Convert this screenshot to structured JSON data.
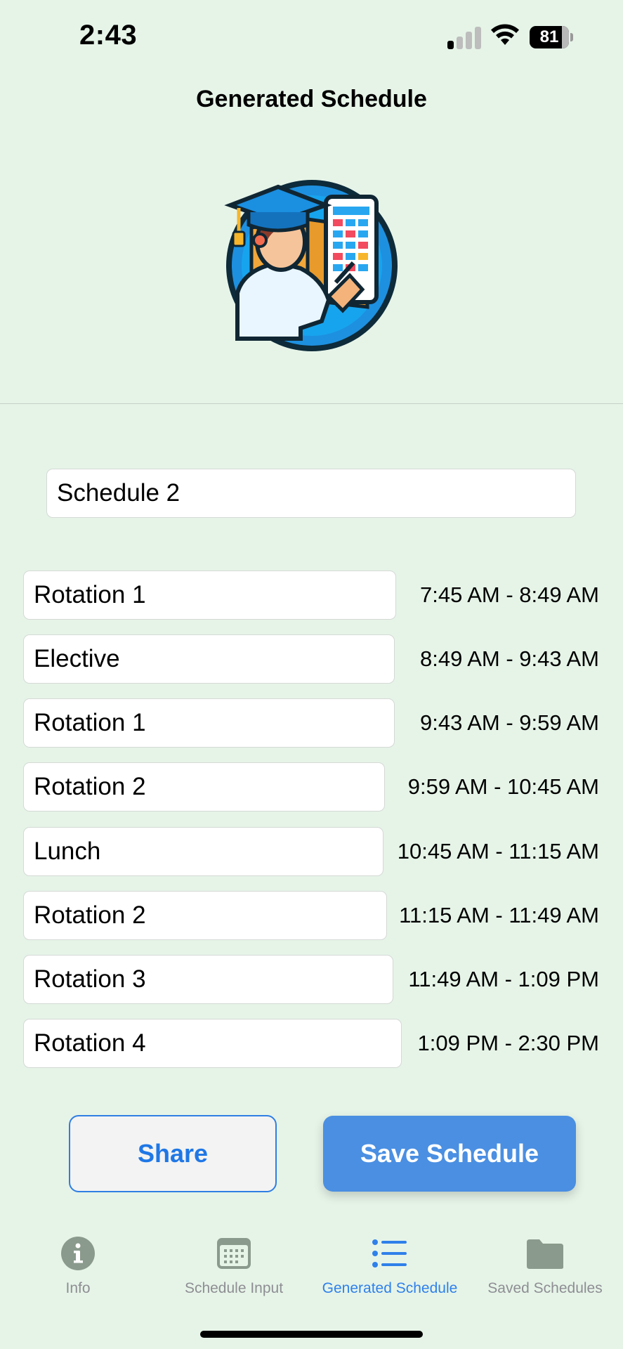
{
  "status_bar": {
    "time": "2:43",
    "battery_level": "81"
  },
  "header": {
    "title": "Generated Schedule"
  },
  "schedule_name": "Schedule 2",
  "schedule": [
    {
      "label": "Rotation 1",
      "time": "7:45 AM - 8:49 AM"
    },
    {
      "label": "Elective",
      "time": "8:49 AM - 9:43 AM"
    },
    {
      "label": "Rotation 1",
      "time": "9:43 AM - 9:59 AM"
    },
    {
      "label": "Rotation 2",
      "time": "9:59 AM - 10:45 AM"
    },
    {
      "label": "Lunch",
      "time": "10:45 AM - 11:15 AM"
    },
    {
      "label": "Rotation 2",
      "time": "11:15 AM - 11:49 AM"
    },
    {
      "label": "Rotation 3",
      "time": "11:49 AM - 1:09 PM"
    },
    {
      "label": "Rotation 4",
      "time": "1:09 PM - 2:30 PM"
    }
  ],
  "actions": {
    "share_label": "Share",
    "save_label": "Save Schedule"
  },
  "tabs": [
    {
      "label": "Info",
      "icon": "info-icon",
      "active": false
    },
    {
      "label": "Schedule Input",
      "icon": "calendar-icon",
      "active": false
    },
    {
      "label": "Generated Schedule",
      "icon": "list-icon",
      "active": true
    },
    {
      "label": "Saved Schedules",
      "icon": "folder-icon",
      "active": false
    }
  ],
  "colors": {
    "background": "#e6f4e8",
    "accent": "#2f80ea",
    "save_button": "#4a8fe2",
    "inactive_tab": "#8e8e93"
  }
}
